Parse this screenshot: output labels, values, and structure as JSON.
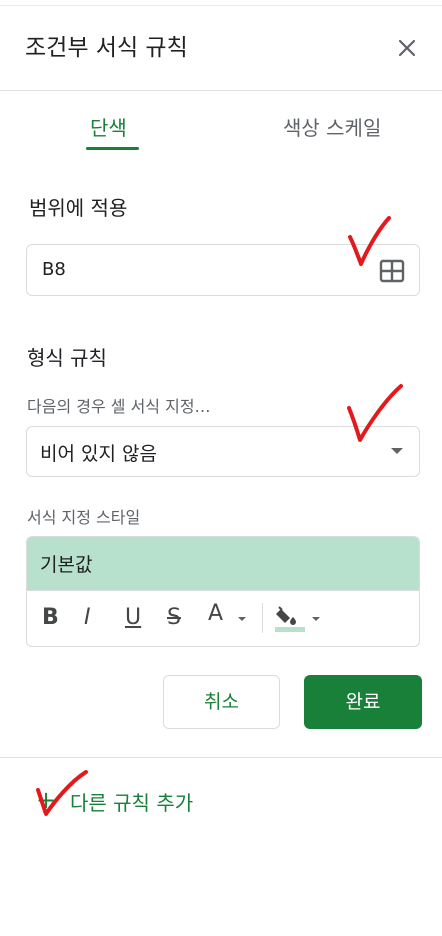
{
  "panel": {
    "title": "조건부 서식 규칙",
    "close_icon": "close-icon"
  },
  "tabs": [
    {
      "label": "단색",
      "active": true
    },
    {
      "label": "색상 스케일",
      "active": false
    }
  ],
  "range": {
    "label": "범위에 적용",
    "value": "B8",
    "icon": "grid-select-icon"
  },
  "rules": {
    "label": "형식 규칙",
    "condition_hint": "다음의 경우 셀 서식 지정…",
    "condition_value": "비어 있지 않음"
  },
  "style": {
    "label": "서식 지정 스타일",
    "preview_text": "기본값",
    "preview_color": "#b7e1cd",
    "toolbar": {
      "bold": "B",
      "italic": "I",
      "underline": "U",
      "strikethrough": "S",
      "text_color": "A",
      "fill_icon": "paint-bucket-icon",
      "fill_color": "#b7e1cd"
    }
  },
  "actions": {
    "cancel": "취소",
    "done": "완료"
  },
  "add_rule": {
    "icon": "+",
    "label": "다른 규칙 추가"
  },
  "colors": {
    "accent": "#188038",
    "annotation": "#e31a1c"
  }
}
